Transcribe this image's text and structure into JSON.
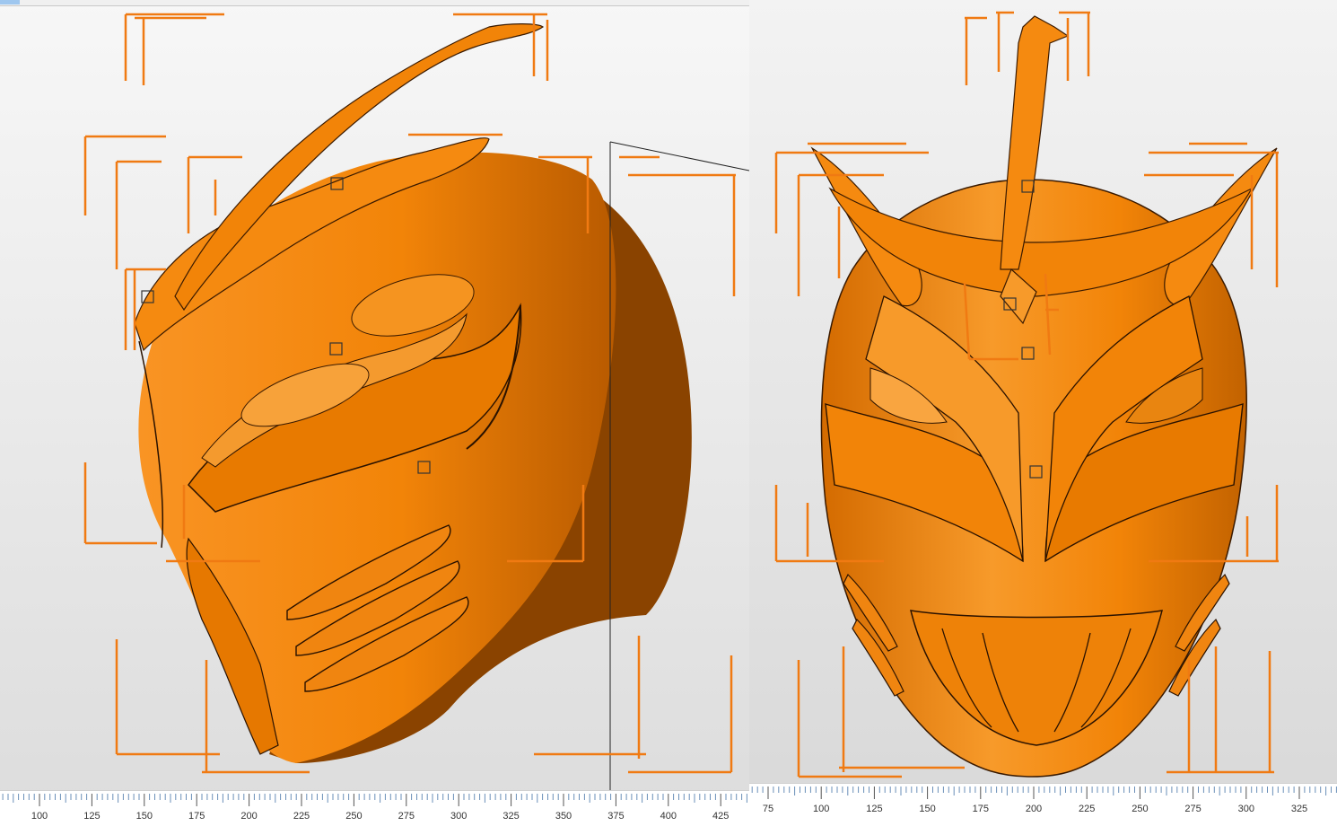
{
  "app": {
    "accent_color": "#ff8000",
    "model_color": "#f58a10",
    "model_shadow_color": "#8a4300",
    "selection_frame_color": "#f07a12"
  },
  "left_view": {
    "ruler_labels": [
      "100",
      "125",
      "150",
      "175",
      "200",
      "225",
      "250",
      "275",
      "300",
      "325",
      "350",
      "375",
      "400",
      "425"
    ]
  },
  "right_view": {
    "ruler_labels": [
      "75",
      "100",
      "125",
      "150",
      "175",
      "200",
      "225",
      "250",
      "275",
      "300",
      "325"
    ]
  }
}
